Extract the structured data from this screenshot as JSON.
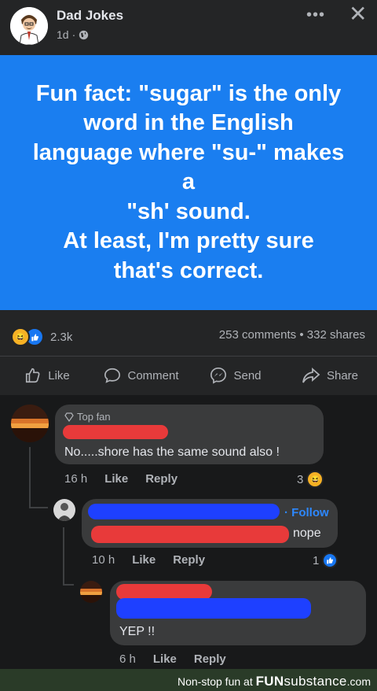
{
  "post": {
    "page_name": "Dad Jokes",
    "time": "1d",
    "card_text": "Fun fact: \"sugar\" is the only\nword in the English\nlanguage where \"su-\" makes\na\n\"sh' sound.\nAt least, I'm pretty sure\nthat's correct.",
    "card_color": "#1a7ef0",
    "reaction_count": "2.3k",
    "comment_count": "253 comments",
    "share_count": "332 shares",
    "separator": "•"
  },
  "actions": {
    "like": "Like",
    "comment": "Comment",
    "send": "Send",
    "share": "Share"
  },
  "comments": [
    {
      "badge": "Top fan",
      "text": "No.....shore has the same sound also !",
      "time": "16 h",
      "like": "Like",
      "reply": "Reply",
      "reaction_count": "3"
    },
    {
      "follow": "Follow",
      "text": "nope",
      "time": "10 h",
      "like": "Like",
      "reply": "Reply",
      "reaction_count": "1"
    },
    {
      "text": "YEP !!",
      "time": "6 h",
      "like": "Like",
      "reply": "Reply"
    }
  ],
  "footer": {
    "tagline": "Non-stop fun at",
    "brand_prefix": "FUN",
    "brand_suffix": "substance",
    "brand_tld": ".com"
  }
}
